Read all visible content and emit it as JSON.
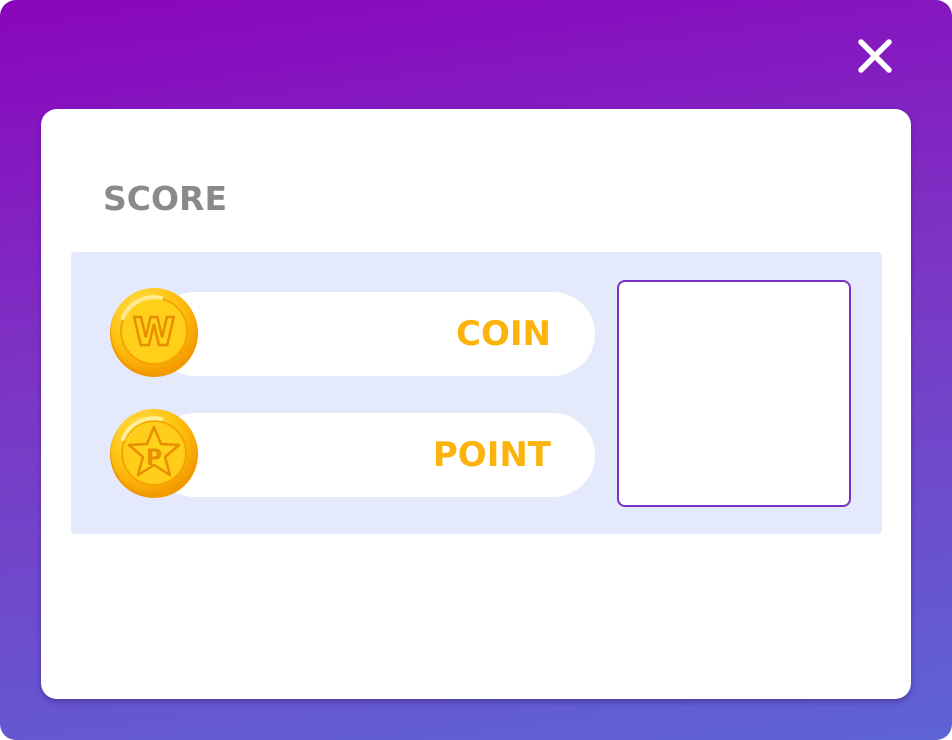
{
  "dialog": {
    "title": "SCORE",
    "close_icon": "close-icon",
    "colors": {
      "gradient_top": "#8a05bd",
      "gradient_bottom": "#5d64d6",
      "panel_bg": "#e4e9fb",
      "label_color": "#fcb30c",
      "title_color": "#8a8a8a",
      "preview_border": "#7a30c6"
    }
  },
  "scores": [
    {
      "icon": "w-coin-icon",
      "icon_letter": "W",
      "label": "COIN"
    },
    {
      "icon": "p-star-coin-icon",
      "icon_letter": "P",
      "label": "POINT"
    }
  ],
  "preview": {
    "value": ""
  }
}
